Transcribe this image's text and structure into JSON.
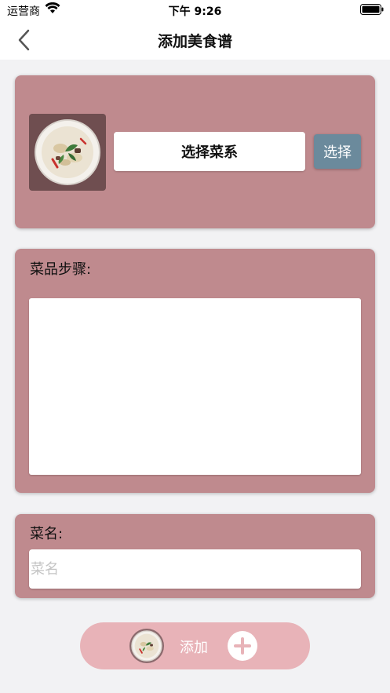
{
  "status_bar": {
    "carrier": "运营商",
    "time": "下午 9:26"
  },
  "nav": {
    "title": "添加美食谱"
  },
  "cuisine": {
    "select_label": "选择菜系",
    "choose_button": "选择"
  },
  "steps": {
    "label": "菜品步骤:",
    "value": ""
  },
  "dish_name": {
    "label": "菜名:",
    "placeholder": "菜名",
    "value": ""
  },
  "add_button": {
    "label": "添加"
  },
  "colors": {
    "card": "#bf8a8e",
    "choose_button": "#6b8a9c",
    "add_bar": "#e8b3b8",
    "thumb_bg": "#6f4e50"
  },
  "icons": [
    "wifi-icon",
    "battery-icon",
    "back-chevron-icon",
    "dish-thumbnail-icon",
    "plus-circle-icon"
  ]
}
